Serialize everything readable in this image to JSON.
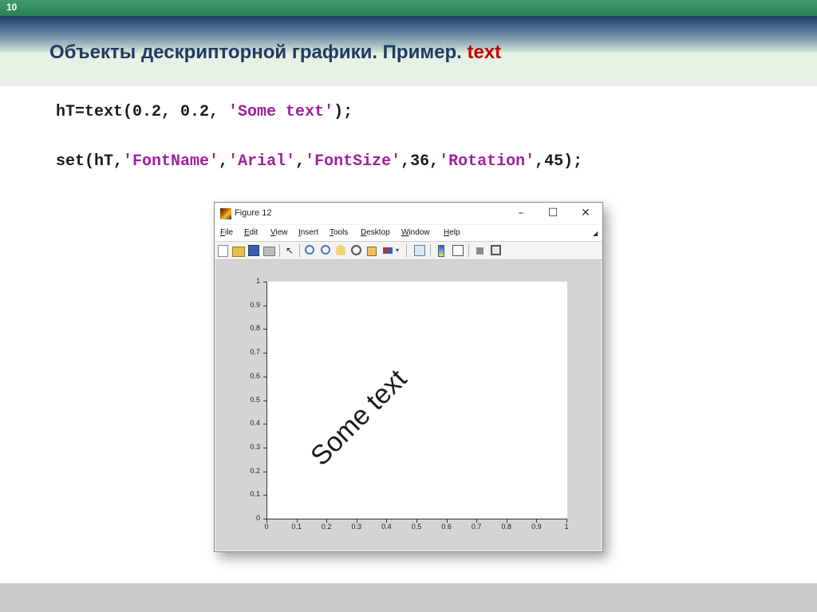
{
  "slide": {
    "number": "10",
    "title_main": "Объекты дескрипторной графики. Пример. ",
    "title_accent": "text"
  },
  "code": {
    "line1": [
      {
        "t": "hT=text(0.2, 0.2, ",
        "s": false
      },
      {
        "t": "'Some text'",
        "s": true
      },
      {
        "t": ");",
        "s": false
      }
    ],
    "line2": [
      {
        "t": "set(hT,",
        "s": false
      },
      {
        "t": "'FontName'",
        "s": true
      },
      {
        "t": ",",
        "s": false
      },
      {
        "t": "'Arial'",
        "s": true
      },
      {
        "t": ",",
        "s": false
      },
      {
        "t": "'FontSize'",
        "s": true
      },
      {
        "t": ",36,",
        "s": false
      },
      {
        "t": "'Rotation'",
        "s": true
      },
      {
        "t": ",45);",
        "s": false
      }
    ]
  },
  "figure_window": {
    "title": "Figure 12",
    "controls": {
      "minimize": "–",
      "maximize": "☐",
      "close": "✕"
    },
    "menu": [
      "File",
      "Edit",
      "View",
      "Insert",
      "Tools",
      "Desktop",
      "Window",
      "Help"
    ],
    "toolbar_icons": [
      "new-figure-icon",
      "open-file-icon",
      "save-icon",
      "print-icon",
      "pointer-icon",
      "zoom-in-icon",
      "zoom-out-icon",
      "pan-icon",
      "rotate-icon",
      "data-cursor-icon",
      "brush-icon",
      "link-plot-icon",
      "colorbar-icon",
      "legend-icon",
      "hide-plot-tools-icon",
      "show-plot-tools-icon"
    ]
  },
  "chart_data": {
    "type": "scatter",
    "title": "",
    "xlabel": "",
    "ylabel": "",
    "xlim": [
      0,
      1
    ],
    "ylim": [
      0,
      1
    ],
    "x_ticks": [
      "0",
      "0.1",
      "0.2",
      "0.3",
      "0.4",
      "0.5",
      "0.6",
      "0.7",
      "0.8",
      "0.9",
      "1"
    ],
    "y_ticks": [
      "0",
      "0.1",
      "0.2",
      "0.3",
      "0.4",
      "0.5",
      "0.6",
      "0.7",
      "0.8",
      "0.9",
      "1"
    ],
    "annotations": [
      {
        "text": "Some text",
        "x": 0.2,
        "y": 0.2,
        "rotation": 45,
        "font_size": 36,
        "font": "Arial"
      }
    ]
  }
}
